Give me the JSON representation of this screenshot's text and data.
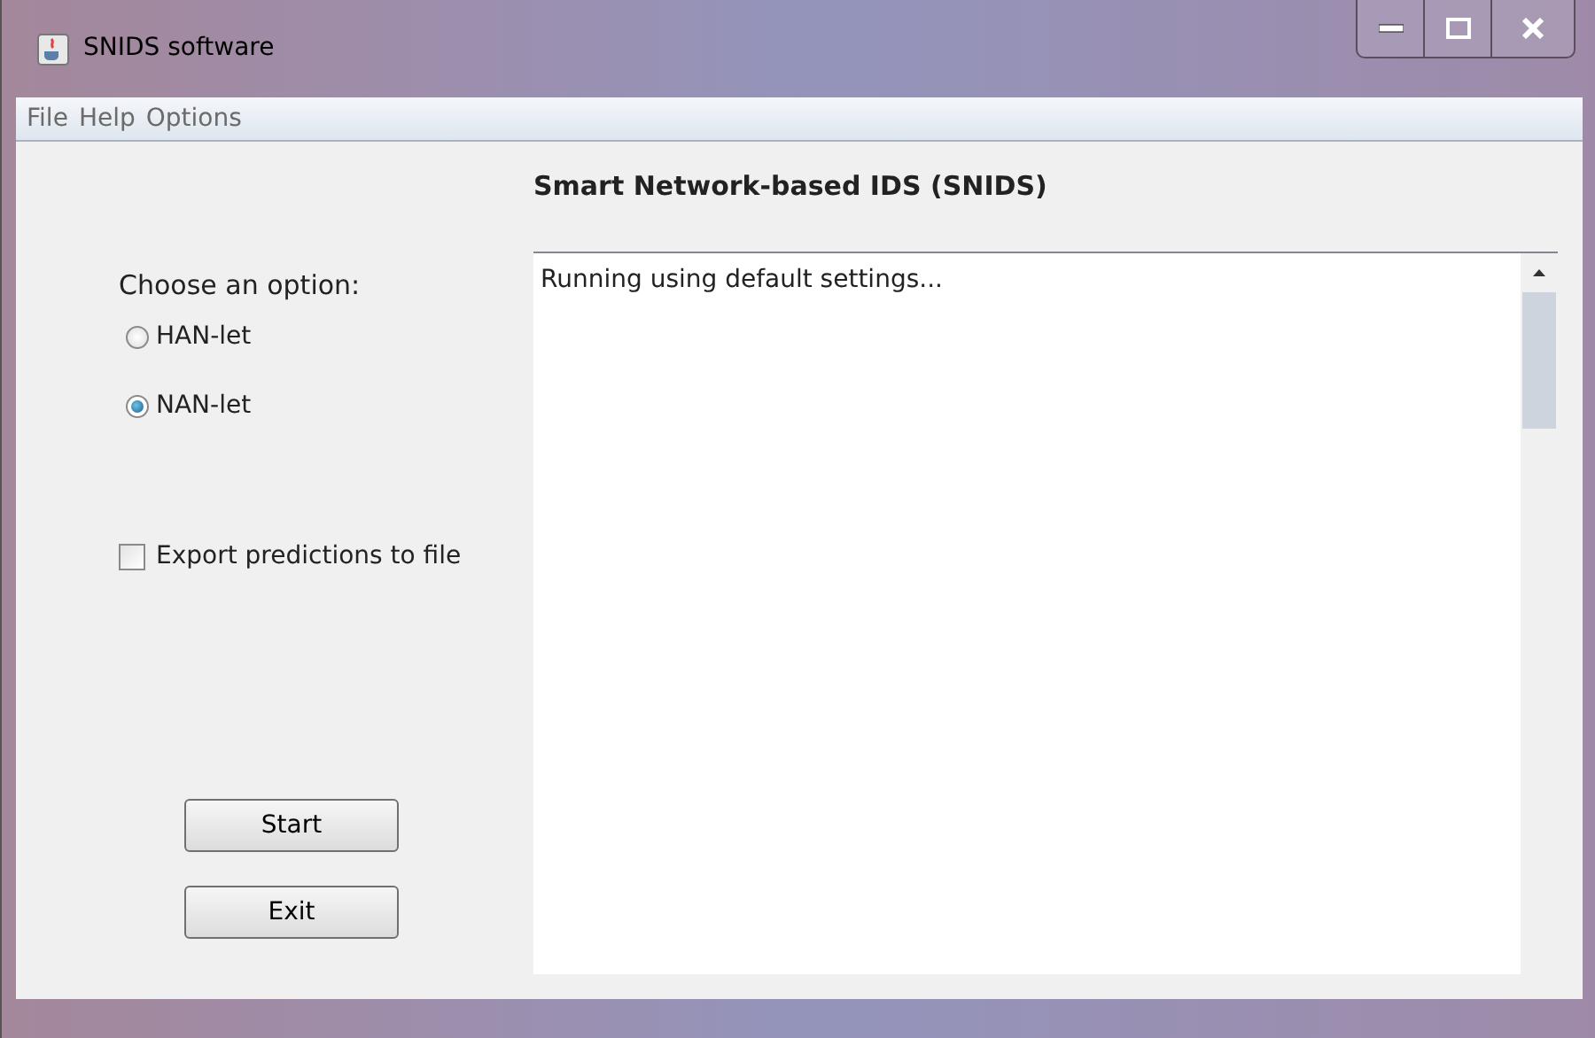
{
  "window": {
    "title": "SNIDS software"
  },
  "menu": [
    "File",
    "Help",
    "Options"
  ],
  "options": {
    "label": "Choose an option:",
    "radios": [
      {
        "label": "HAN-let",
        "selected": false
      },
      {
        "label": "NAN-let",
        "selected": true
      }
    ]
  },
  "export": {
    "label": "Export predictions to file",
    "checked": false
  },
  "buttons": [
    "Start",
    "Exit"
  ],
  "heading": "Smart Network-based IDS (SNIDS)",
  "log": "Running using default settings..."
}
